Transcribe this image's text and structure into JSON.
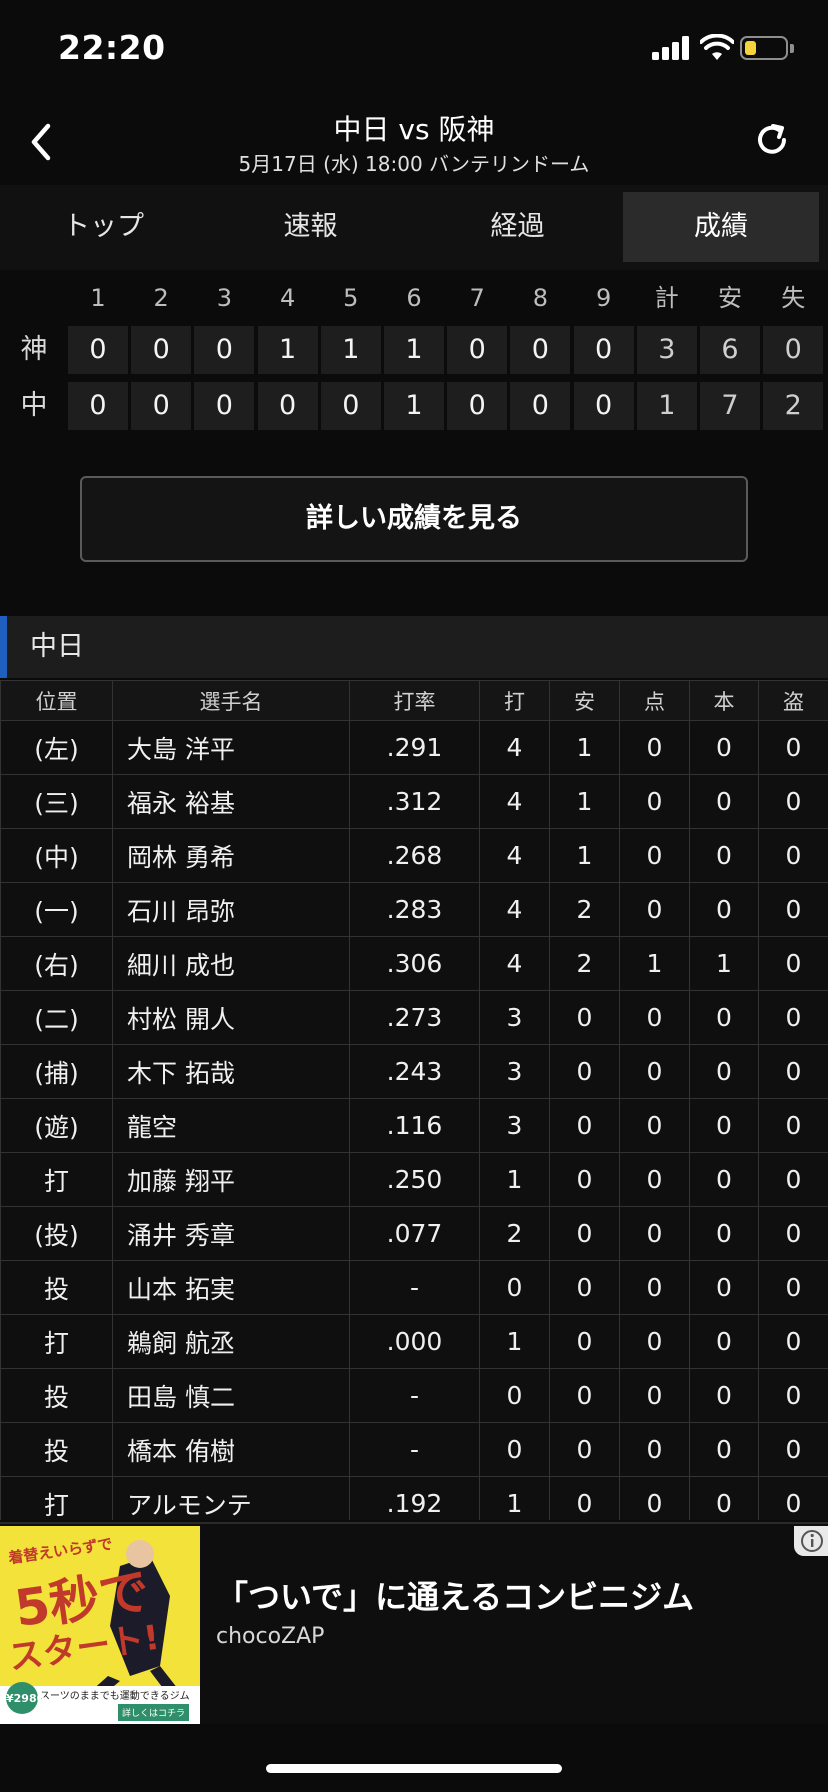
{
  "status": {
    "time": "22:20"
  },
  "header": {
    "title": "中日 vs 阪神",
    "subtitle": "5月17日 (水) 18:00 バンテリンドーム"
  },
  "tabs": [
    {
      "label": "トップ",
      "active": false
    },
    {
      "label": "速報",
      "active": false
    },
    {
      "label": "経過",
      "active": false
    },
    {
      "label": "成績",
      "active": true
    }
  ],
  "scoreboard": {
    "headers": [
      "1",
      "2",
      "3",
      "4",
      "5",
      "6",
      "7",
      "8",
      "9",
      "計",
      "安",
      "失"
    ],
    "rows": [
      {
        "team": "神",
        "cells": [
          "0",
          "0",
          "0",
          "1",
          "1",
          "1",
          "0",
          "0",
          "0",
          "3",
          "6",
          "0"
        ]
      },
      {
        "team": "中",
        "cells": [
          "0",
          "0",
          "0",
          "0",
          "0",
          "1",
          "0",
          "0",
          "0",
          "1",
          "7",
          "2"
        ]
      }
    ]
  },
  "detail_button": "詳しい成績を見る",
  "team_section": {
    "name": "中日",
    "columns": [
      "位置",
      "選手名",
      "打率",
      "打",
      "安",
      "点",
      "本",
      "盗"
    ],
    "rows": [
      [
        "(左)",
        "大島 洋平",
        ".291",
        "4",
        "1",
        "0",
        "0",
        "0"
      ],
      [
        "(三)",
        "福永 裕基",
        ".312",
        "4",
        "1",
        "0",
        "0",
        "0"
      ],
      [
        "(中)",
        "岡林 勇希",
        ".268",
        "4",
        "1",
        "0",
        "0",
        "0"
      ],
      [
        "(一)",
        "石川 昂弥",
        ".283",
        "4",
        "2",
        "0",
        "0",
        "0"
      ],
      [
        "(右)",
        "細川 成也",
        ".306",
        "4",
        "2",
        "1",
        "1",
        "0"
      ],
      [
        "(二)",
        "村松 開人",
        ".273",
        "3",
        "0",
        "0",
        "0",
        "0"
      ],
      [
        "(捕)",
        "木下 拓哉",
        ".243",
        "3",
        "0",
        "0",
        "0",
        "0"
      ],
      [
        "(遊)",
        "龍空",
        ".116",
        "3",
        "0",
        "0",
        "0",
        "0"
      ],
      [
        "打",
        "加藤 翔平",
        ".250",
        "1",
        "0",
        "0",
        "0",
        "0"
      ],
      [
        "(投)",
        "涌井 秀章",
        ".077",
        "2",
        "0",
        "0",
        "0",
        "0"
      ],
      [
        "投",
        "山本 拓実",
        "-",
        "0",
        "0",
        "0",
        "0",
        "0"
      ],
      [
        "打",
        "鵜飼 航丞",
        ".000",
        "1",
        "0",
        "0",
        "0",
        "0"
      ],
      [
        "投",
        "田島 慎二",
        "-",
        "0",
        "0",
        "0",
        "0",
        "0"
      ],
      [
        "投",
        "橋本 侑樹",
        "-",
        "0",
        "0",
        "0",
        "0",
        "0"
      ],
      [
        "打",
        "アルモンテ",
        ".192",
        "1",
        "0",
        "0",
        "0",
        "0"
      ]
    ]
  },
  "ad": {
    "headline": "「ついで」に通えるコンビニジム",
    "brand": "chocoZAP",
    "image_text_1": "着替えいらずで",
    "image_text_2": "5秒で",
    "image_text_3": "スタート!",
    "image_text_4": "スーツのままでも運動できるジム",
    "image_price": "¥2980",
    "image_button": "詳しくはコチラ"
  },
  "colors": {
    "accent_blue": "#1f5fbf",
    "battery_yellow": "#f5d33a"
  }
}
